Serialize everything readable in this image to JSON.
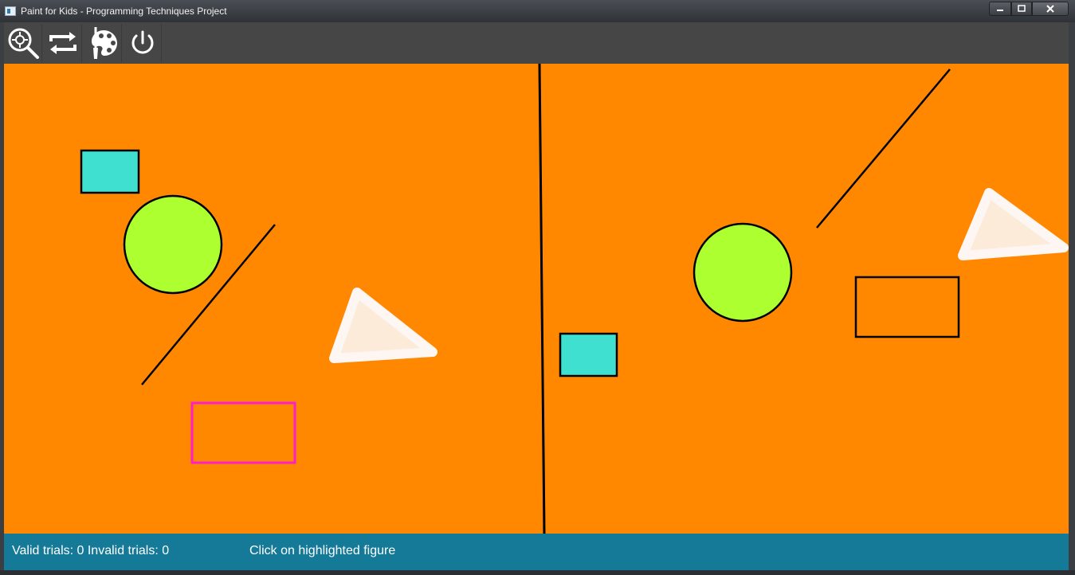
{
  "window": {
    "title": "Paint for Kids - Programming Techniques Project",
    "controls": {
      "minimize_icon": "minimize-icon",
      "maximize_icon": "maximize-icon",
      "close_icon": "close-icon"
    }
  },
  "toolbar": {
    "tools": [
      {
        "id": "find",
        "icon": "zoom-target-icon"
      },
      {
        "id": "swap",
        "icon": "swap-arrows-icon"
      },
      {
        "id": "color",
        "icon": "palette-icon"
      },
      {
        "id": "exit",
        "icon": "power-icon"
      }
    ]
  },
  "colors": {
    "canvas_bg": "#ff8800",
    "toolbar_bg": "#464646",
    "status_bg": "#147a98",
    "cyan_fill": "#40e0d0",
    "green_fill": "#adff2f",
    "triangle_fill": "#fcebd8",
    "triangle_border": "#fdf6f3",
    "highlight_border": "#ff1fc8",
    "outline": "#000000"
  },
  "status": {
    "trials_text": "Valid trials: 0 Invalid trials: 0",
    "message": "Click on highlighted figure"
  }
}
